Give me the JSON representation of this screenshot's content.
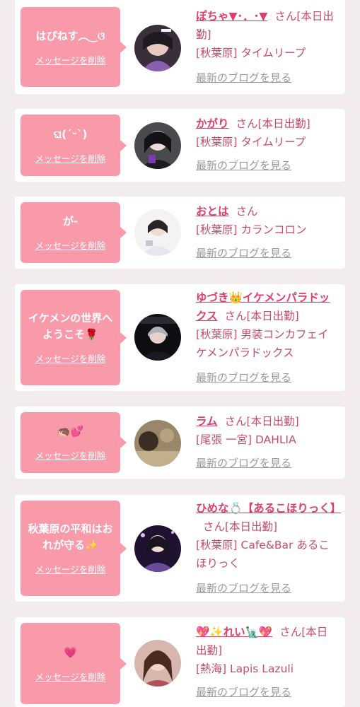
{
  "cards": [
    {
      "message": "はぴねす︵‿ଓ",
      "delete_label": "メッセージを削除",
      "name": "ぽちゃ▼･．･▼",
      "suffix": "さん[本日出勤]",
      "location": "[秋葉原] タイムリープ",
      "blog_label": "最新のブログを見る"
    },
    {
      "message": "ଘ(ˊᵕˋ)",
      "delete_label": "メッセージを削除",
      "name": "かがり",
      "suffix": "さん[本日出勤]",
      "location": "[秋葉原] タイムリープ",
      "blog_label": "最新のブログを見る"
    },
    {
      "message": "が-",
      "delete_label": "メッセージを削除",
      "name": "おとは",
      "suffix": "さん",
      "location": "[秋葉原] カランコロン",
      "blog_label": "最新のブログを見る"
    },
    {
      "message": "イケメンの世界へようこそ🌹",
      "delete_label": "メッセージを削除",
      "name": "ゆづき👑イケメンパラドックス",
      "suffix": "さん[本日出勤]",
      "location": "[秋葉原] 男装コンカフェイケメンパラドックス",
      "blog_label": "最新のブログを見る"
    },
    {
      "message": "🦔💕",
      "delete_label": "メッセージを削除",
      "name": "ラム",
      "suffix": "さん[本日出勤]",
      "location": "[尾張 一宮] DAHLIA",
      "blog_label": "最新のブログを見る"
    },
    {
      "message": "秋葉原の平和はおれが守る✨",
      "delete_label": "メッセージを削除",
      "name": "ひめな💍【あるこほりっく】",
      "suffix": "さん[本日出勤]",
      "location": "[秋葉原] Cafe&Bar あるこほりっく",
      "blog_label": "最新のブログを見る"
    },
    {
      "message": "💗",
      "delete_label": "メッセージを削除",
      "name": "💖✨れい🗽💖",
      "suffix": "さん[本日出勤]",
      "location": "[熱海] Lapis Lazuli",
      "blog_label": "最新のブログを見る"
    }
  ],
  "colors": {
    "background": "#f2ecee",
    "bubble": "#f99aaa",
    "name": "#e23d6a",
    "text": "#c94b6b",
    "link_gray": "#9a9a9a"
  }
}
